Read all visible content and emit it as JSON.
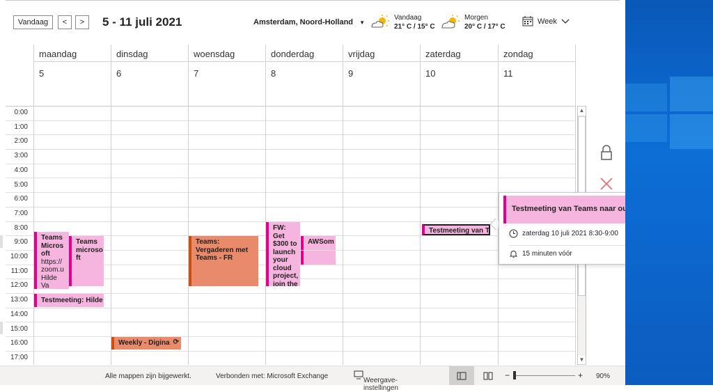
{
  "toolbar": {
    "today_label": "Vandaag",
    "prev_label": "<",
    "next_label": ">",
    "date_range": "5 - 11 juli 2021",
    "location": "Amsterdam, Noord-Holland",
    "view_label": "Week"
  },
  "weather": {
    "today": {
      "label": "Vandaag",
      "temps": "21° C / 15° C"
    },
    "tomorrow": {
      "label": "Morgen",
      "temps": "20° C / 17° C"
    }
  },
  "days": [
    {
      "name": "maandag",
      "num": "5"
    },
    {
      "name": "dinsdag",
      "num": "6"
    },
    {
      "name": "woensdag",
      "num": "7"
    },
    {
      "name": "donderdag",
      "num": "8"
    },
    {
      "name": "vrijdag",
      "num": "9"
    },
    {
      "name": "zaterdag",
      "num": "10"
    },
    {
      "name": "zondag",
      "num": "11"
    }
  ],
  "hours": [
    "0:00",
    "1:00",
    "2:00",
    "3:00",
    "4:00",
    "5:00",
    "6:00",
    "7:00",
    "8:00",
    "9:00",
    "10:00",
    "11:00",
    "12:00",
    "13:00",
    "14:00",
    "15:00",
    "16:00",
    "17:00"
  ],
  "events": {
    "mon1": {
      "l1": "Teams",
      "l2": "Micros",
      "l3": "oft",
      "l4": "https://",
      "l5": "zoom.u",
      "l6": "Hilde Va"
    },
    "mon2": {
      "l1": "Teams",
      "l2": "microso",
      "l3": "ft"
    },
    "mon3": "Testmeeting: Hilde",
    "tue1": "Weekly - Digina",
    "wed1": {
      "l1": "Teams:",
      "l2": "Vergaderen met",
      "l3": "Teams - FR"
    },
    "thu1": {
      "l1": "FW: Get",
      "l2": "$300 to",
      "l3": "launch",
      "l4": "your",
      "l5": "cloud",
      "l6": "project,",
      "l7": "join the"
    },
    "thu2": "AWSom",
    "sat1": "Testmeeting van T"
  },
  "popup": {
    "title": "Testmeeting van Teams naar outlook",
    "when": "zaterdag 10 juli 2021 8:30-9:00",
    "reminder": "15 minuten vóór"
  },
  "status": {
    "sync": "Alle mappen zijn bijgewerkt.",
    "connected": "Verbonden met: Microsoft Exchange",
    "view_settings": "Weergave-instellingen",
    "zoom": "90%"
  },
  "colors": {
    "accent_pink": "#e3008c",
    "event_pink": "#f6b5de",
    "event_orange": "#e98b6a",
    "orange_border": "#ca5010"
  }
}
